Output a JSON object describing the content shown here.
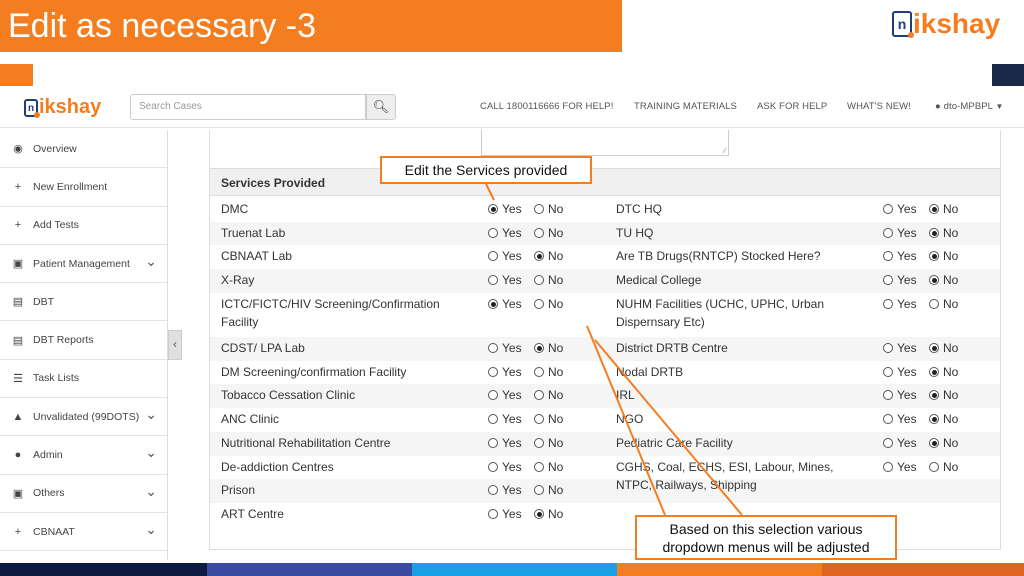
{
  "slide": {
    "title": "Edit as necessary -3"
  },
  "logo": {
    "mark": "n",
    "text": "ikshay"
  },
  "navbar": {
    "search_placeholder": "Search Cases",
    "links": [
      "CALL 1800116666 FOR HELP!",
      "TRAINING MATERIALS",
      "ASK FOR HELP",
      "WHAT'S NEW!"
    ],
    "user": "dto-MPBPL"
  },
  "sidebar": {
    "items": [
      {
        "label": "Overview",
        "icon": "dashboard-icon",
        "glyph": "◉",
        "chevron": false
      },
      {
        "label": "New Enrollment",
        "icon": "plus-icon",
        "glyph": "+",
        "chevron": false
      },
      {
        "label": "Add Tests",
        "icon": "plus-icon",
        "glyph": "+",
        "chevron": false
      },
      {
        "label": "Patient Management",
        "icon": "briefcase-icon",
        "glyph": "▣",
        "chevron": true
      },
      {
        "label": "DBT",
        "icon": "money-icon",
        "glyph": "▤",
        "chevron": false
      },
      {
        "label": "DBT Reports",
        "icon": "money-icon",
        "glyph": "▤",
        "chevron": false
      },
      {
        "label": "Task Lists",
        "icon": "list-icon",
        "glyph": "☰",
        "chevron": false
      },
      {
        "label": "Unvalidated (99DOTS)",
        "icon": "warning-icon",
        "glyph": "▲",
        "chevron": true
      },
      {
        "label": "Admin",
        "icon": "user-icon",
        "glyph": "●",
        "chevron": true
      },
      {
        "label": "Others",
        "icon": "briefcase-icon",
        "glyph": "▣",
        "chevron": true
      },
      {
        "label": "CBNAAT",
        "icon": "plus-icon",
        "glyph": "+",
        "chevron": true
      }
    ]
  },
  "services": {
    "header": "Services Provided",
    "yes_label": "Yes",
    "no_label": "No",
    "left": [
      {
        "name": "DMC",
        "selected": "Yes"
      },
      {
        "name": "Truenat Lab",
        "selected": null
      },
      {
        "name": "CBNAAT Lab",
        "selected": "No"
      },
      {
        "name": "X-Ray",
        "selected": null
      },
      {
        "name": "ICTC/FICTC/HIV Screening/Confirmation Facility",
        "selected": "Yes"
      },
      {
        "name": "CDST/ LPA Lab",
        "selected": "No"
      },
      {
        "name": "DM Screening/confirmation Facility",
        "selected": null
      },
      {
        "name": "Tobacco Cessation Clinic",
        "selected": null
      },
      {
        "name": "ANC Clinic",
        "selected": null
      },
      {
        "name": "Nutritional Rehabilitation Centre",
        "selected": null
      },
      {
        "name": "De-addiction Centres",
        "selected": null
      },
      {
        "name": "Prison",
        "selected": null
      },
      {
        "name": "ART Centre",
        "selected": "No"
      }
    ],
    "right": [
      {
        "name": "DTC HQ",
        "selected": "No"
      },
      {
        "name": "TU HQ",
        "selected": "No"
      },
      {
        "name": "Are TB Drugs(RNTCP) Stocked Here?",
        "selected": "No"
      },
      {
        "name": "Medical College",
        "selected": "No"
      },
      {
        "name": "NUHM Facilities (UCHC, UPHC, Urban Dispernsary Etc)",
        "selected": null
      },
      {
        "name": "District DRTB Centre",
        "selected": "No"
      },
      {
        "name": "Nodal DRTB",
        "selected": "No"
      },
      {
        "name": "IRL",
        "selected": "No"
      },
      {
        "name": "NGO",
        "selected": "No"
      },
      {
        "name": "Pediatric Care Facility",
        "selected": "No"
      },
      {
        "name": "CGHS, Coal, ECHS, ESI, Labour, Mines, NTPC, Railways, Shipping",
        "selected": null
      }
    ]
  },
  "callouts": {
    "edit": "Edit the Services provided",
    "dropdown": "Based on this selection various dropdown menus will be adjusted"
  },
  "colors": {
    "accent": "#f47d20",
    "navy": "#1b2a4a",
    "footer": [
      "#0d1b40",
      "#3b4ba3",
      "#1aa0e6",
      "#f47d20",
      "#e0641f"
    ]
  }
}
